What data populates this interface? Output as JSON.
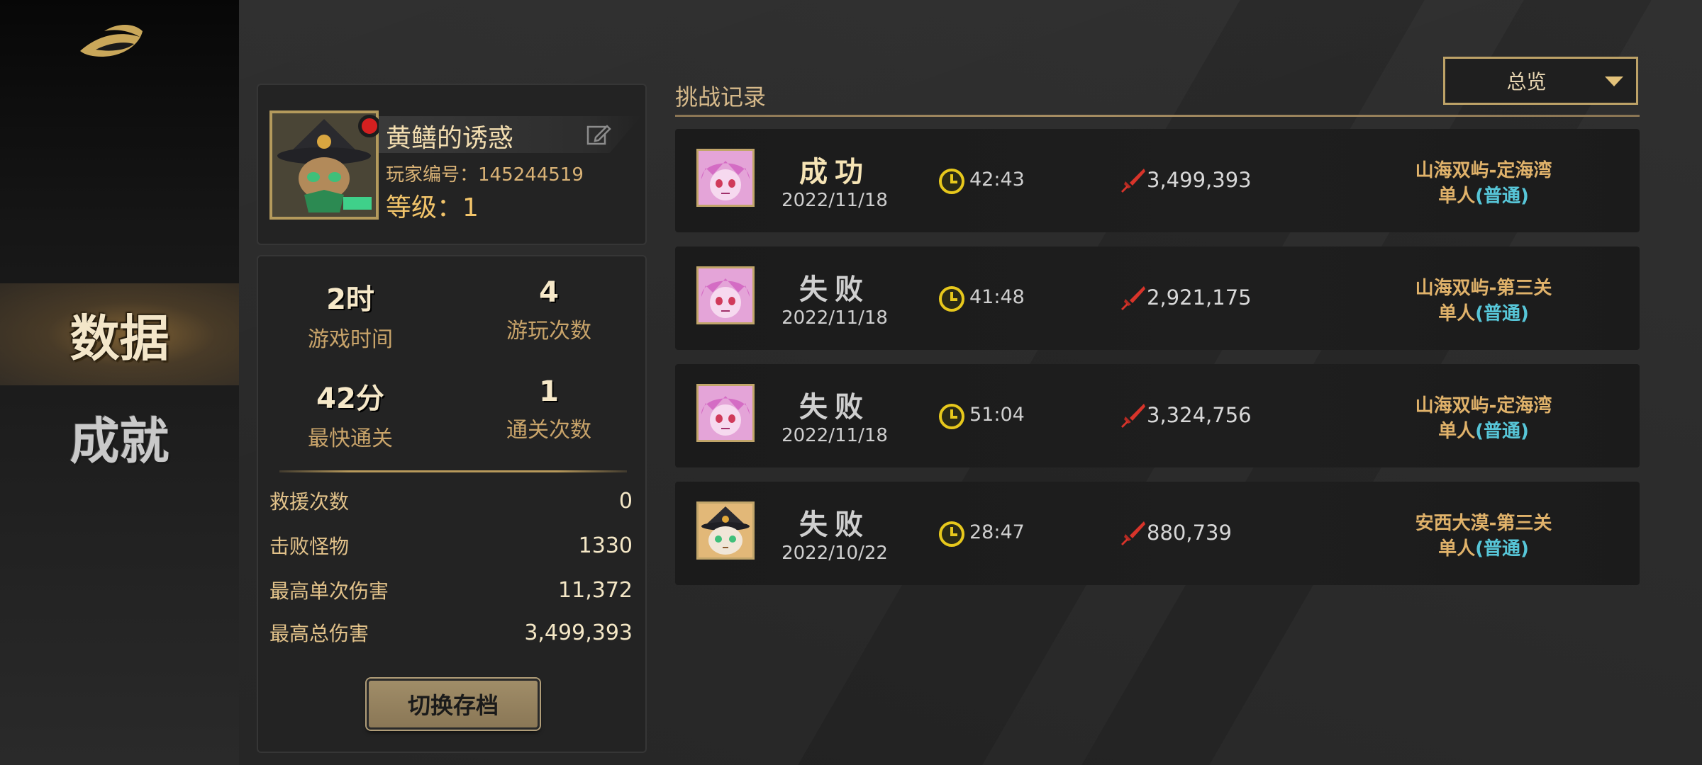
{
  "sidebar": {
    "items": [
      {
        "label": "数据",
        "active": true
      },
      {
        "label": "成就",
        "active": false
      }
    ]
  },
  "profile": {
    "name": "黄鳝的诱惑",
    "player_id": "玩家编号：145244519",
    "level": "等级：1"
  },
  "stats": {
    "play_time": {
      "value": "2时",
      "label": "游戏时间"
    },
    "play_count": {
      "value": "4",
      "label": "游玩次数"
    },
    "fastest_clear": {
      "value": "42分",
      "label": "最快通关"
    },
    "clear_count": {
      "value": "1",
      "label": "通关次数"
    },
    "rows": [
      {
        "label": "救援次数",
        "value": "0"
      },
      {
        "label": "击败怪物",
        "value": "1330"
      },
      {
        "label": "最高单次伤害",
        "value": "11,372"
      },
      {
        "label": "最高总伤害",
        "value": "3,499,393"
      }
    ],
    "switch_button": "切换存档"
  },
  "records": {
    "title": "挑战记录",
    "filter": "总览",
    "items": [
      {
        "result": "成功",
        "win": true,
        "date": "2022/11/18",
        "time": "42:43",
        "damage": "3,499,393",
        "stage": "山海双屿-定海湾",
        "mode_prefix": "单人",
        "mode": "(普通)",
        "avatar": "pink"
      },
      {
        "result": "失败",
        "win": false,
        "date": "2022/11/18",
        "time": "41:48",
        "damage": "2,921,175",
        "stage": "山海双屿-第三关",
        "mode_prefix": "单人",
        "mode": "(普通)",
        "avatar": "pink"
      },
      {
        "result": "失败",
        "win": false,
        "date": "2022/11/18",
        "time": "51:04",
        "damage": "3,324,756",
        "stage": "山海双屿-定海湾",
        "mode_prefix": "单人",
        "mode": "(普通)",
        "avatar": "pink"
      },
      {
        "result": "失败",
        "win": false,
        "date": "2022/10/22",
        "time": "28:47",
        "damage": "880,739",
        "stage": "安西大漠-第三关",
        "mode_prefix": "单人",
        "mode": "(普通)",
        "avatar": "cat"
      }
    ]
  },
  "colors": {
    "gold": "#d9b276",
    "cyan_mode": "#57c6d8",
    "frame": "#c1a56a"
  }
}
